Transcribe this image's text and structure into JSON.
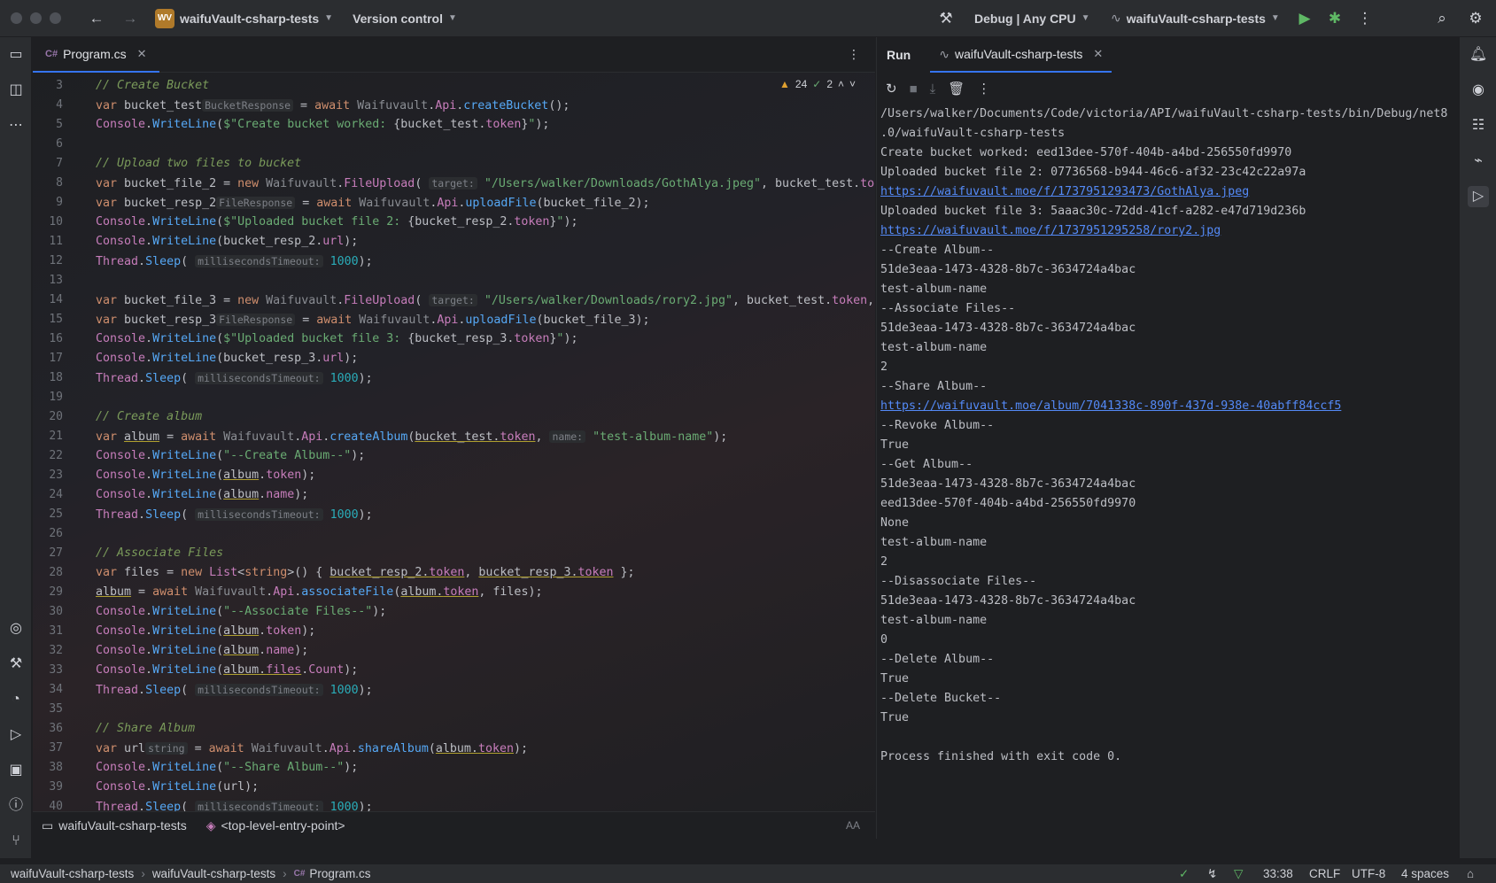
{
  "titlebar": {
    "project_badge": "WV",
    "project_name": "waifuVault-csharp-tests",
    "vcs": "Version control",
    "config": "Debug | Any CPU",
    "run_config": "waifuVault-csharp-tests"
  },
  "editor": {
    "tab_label": "Program.cs",
    "tab_lang": "C#",
    "warnings": "24",
    "weak": "2",
    "lines": [
      {
        "n": "3",
        "html": "<span class=\"cm\">// Create Bucket</span>"
      },
      {
        "n": "4",
        "html": "<span class=\"kw\">var</span> bucket_test<span class=\"hint\">BucketResponse</span> = <span class=\"kw\">await</span> <span class=\"ns\">Waifuvault</span>.<span class=\"ty\">Api</span>.<span class=\"fn\">createBucket</span>();"
      },
      {
        "n": "5",
        "html": "<span class=\"ty\">Console</span>.<span class=\"fn\">WriteLine</span>(<span class=\"str\">$\"Create bucket worked: </span>{bucket_test.<span class=\"prop\">token</span>}<span class=\"str\">\"</span>);"
      },
      {
        "n": "6",
        "html": ""
      },
      {
        "n": "7",
        "html": "<span class=\"cm\">// Upload two files to bucket</span>"
      },
      {
        "n": "8",
        "html": "<span class=\"kw\">var</span> bucket_file_2 = <span class=\"kw\">new</span> <span class=\"ns\">Waifuvault</span>.<span class=\"ty\">FileUpload</span>( <span class=\"hint\">target:</span> <span class=\"str\">\"/Users/walker/Downloads/GothAlya.jpeg\"</span>, bucket_test.<span class=\"prop\">token</span>, <span class=\"hint\">e</span>"
      },
      {
        "n": "9",
        "html": "<span class=\"kw\">var</span> bucket_resp_2<span class=\"hint\">FileResponse</span> = <span class=\"kw\">await</span> <span class=\"ns\">Waifuvault</span>.<span class=\"ty\">Api</span>.<span class=\"fn\">uploadFile</span>(bucket_file_2);"
      },
      {
        "n": "10",
        "html": "<span class=\"ty\">Console</span>.<span class=\"fn\">WriteLine</span>(<span class=\"str\">$\"Uploaded bucket file 2: </span>{bucket_resp_2.<span class=\"prop\">token</span>}<span class=\"str\">\"</span>);"
      },
      {
        "n": "11",
        "html": "<span class=\"ty\">Console</span>.<span class=\"fn\">WriteLine</span>(bucket_resp_2.<span class=\"prop\">url</span>);"
      },
      {
        "n": "12",
        "html": "<span class=\"ty\">Thread</span>.<span class=\"fn\">Sleep</span>( <span class=\"hint\">millisecondsTimeout:</span> <span class=\"num\">1000</span>);"
      },
      {
        "n": "13",
        "html": ""
      },
      {
        "n": "14",
        "html": "<span class=\"kw\">var</span> bucket_file_3 = <span class=\"kw\">new</span> <span class=\"ns\">Waifuvault</span>.<span class=\"ty\">FileUpload</span>( <span class=\"hint\">target:</span> <span class=\"str\">\"/Users/walker/Downloads/rory2.jpg\"</span>, bucket_test.<span class=\"prop\">token</span>, <span class=\"hint\">expires</span>"
      },
      {
        "n": "15",
        "html": "<span class=\"kw\">var</span> bucket_resp_3<span class=\"hint\">FileResponse</span> = <span class=\"kw\">await</span> <span class=\"ns\">Waifuvault</span>.<span class=\"ty\">Api</span>.<span class=\"fn\">uploadFile</span>(bucket_file_3);"
      },
      {
        "n": "16",
        "html": "<span class=\"ty\">Console</span>.<span class=\"fn\">WriteLine</span>(<span class=\"str\">$\"Uploaded bucket file 3: </span>{bucket_resp_3.<span class=\"prop\">token</span>}<span class=\"str\">\"</span>);"
      },
      {
        "n": "17",
        "html": "<span class=\"ty\">Console</span>.<span class=\"fn\">WriteLine</span>(bucket_resp_3.<span class=\"prop\">url</span>);"
      },
      {
        "n": "18",
        "html": "<span class=\"ty\">Thread</span>.<span class=\"fn\">Sleep</span>( <span class=\"hint\">millisecondsTimeout:</span> <span class=\"num\">1000</span>);"
      },
      {
        "n": "19",
        "html": ""
      },
      {
        "n": "20",
        "html": "<span class=\"cm\">// Create album</span>"
      },
      {
        "n": "21",
        "html": "<span class=\"kw\">var</span> <span class=\"und\">album</span> = <span class=\"kw\">await</span> <span class=\"ns\">Waifuvault</span>.<span class=\"ty\">Api</span>.<span class=\"fn\">createAlbum</span>(<span class=\"und\">bucket_test.<span class=\"prop\">token</span></span>, <span class=\"hint\">name:</span> <span class=\"str\">\"test-album-name\"</span>);"
      },
      {
        "n": "22",
        "html": "<span class=\"ty\">Console</span>.<span class=\"fn\">WriteLine</span>(<span class=\"str\">\"--Create Album--\"</span>);"
      },
      {
        "n": "23",
        "html": "<span class=\"ty\">Console</span>.<span class=\"fn\">WriteLine</span>(<span class=\"und\">album</span>.<span class=\"prop\">token</span>);"
      },
      {
        "n": "24",
        "html": "<span class=\"ty\">Console</span>.<span class=\"fn\">WriteLine</span>(<span class=\"und\">album</span>.<span class=\"prop\">name</span>);"
      },
      {
        "n": "25",
        "html": "<span class=\"ty\">Thread</span>.<span class=\"fn\">Sleep</span>( <span class=\"hint\">millisecondsTimeout:</span> <span class=\"num\">1000</span>);"
      },
      {
        "n": "26",
        "html": ""
      },
      {
        "n": "27",
        "html": "<span class=\"cm\">// Associate Files</span>"
      },
      {
        "n": "28",
        "html": "<span class=\"kw\">var</span> files = <span class=\"kw\">new</span> <span class=\"ty\">List</span>&lt;<span class=\"kw\">string</span>&gt;() { <span class=\"und\">bucket_resp_2.<span class=\"prop\">token</span></span>, <span class=\"und\">bucket_resp_3.<span class=\"prop\">token</span></span> };"
      },
      {
        "n": "29",
        "html": "<span class=\"und\">album</span> = <span class=\"kw\">await</span> <span class=\"ns\">Waifuvault</span>.<span class=\"ty\">Api</span>.<span class=\"fn\">associateFile</span>(<span class=\"und\">album.<span class=\"prop\">token</span></span>, files);"
      },
      {
        "n": "30",
        "html": "<span class=\"ty\">Console</span>.<span class=\"fn\">WriteLine</span>(<span class=\"str\">\"--Associate Files--\"</span>);"
      },
      {
        "n": "31",
        "html": "<span class=\"ty\">Console</span>.<span class=\"fn\">WriteLine</span>(<span class=\"und\">album</span>.<span class=\"prop\">token</span>);"
      },
      {
        "n": "32",
        "html": "<span class=\"ty\">Console</span>.<span class=\"fn\">WriteLine</span>(<span class=\"und\">album</span>.<span class=\"prop\">name</span>);"
      },
      {
        "n": "33",
        "html": "<span class=\"ty\">Console</span>.<span class=\"fn\">WriteLine</span>(<span class=\"und\">album.<span class=\"prop\">files</span></span>.<span class=\"prop\">Count</span>);"
      },
      {
        "n": "34",
        "html": "<span class=\"ty\">Thread</span>.<span class=\"fn\">Sleep</span>( <span class=\"hint\">millisecondsTimeout:</span> <span class=\"num\">1000</span>);"
      },
      {
        "n": "35",
        "html": ""
      },
      {
        "n": "36",
        "html": "<span class=\"cm\">// Share Album</span>"
      },
      {
        "n": "37",
        "html": "<span class=\"kw\">var</span> url<span class=\"hint\">string</span> = <span class=\"kw\">await</span> <span class=\"ns\">Waifuvault</span>.<span class=\"ty\">Api</span>.<span class=\"fn\">shareAlbum</span>(<span class=\"und\">album.<span class=\"prop\">token</span></span>);"
      },
      {
        "n": "38",
        "html": "<span class=\"ty\">Console</span>.<span class=\"fn\">WriteLine</span>(<span class=\"str\">\"--Share Album--\"</span>);"
      },
      {
        "n": "39",
        "html": "<span class=\"ty\">Console</span>.<span class=\"fn\">WriteLine</span>(url);"
      },
      {
        "n": "40",
        "html": "<span class=\"ty\">Thread</span>.<span class=\"fn\">Sleep</span>( <span class=\"hint\">millisecondsTimeout:</span> <span class=\"num\">1000</span>);"
      },
      {
        "n": "41",
        "html": ""
      }
    ],
    "bread_project": "waifuVault-csharp-tests",
    "bread_scope": "<top-level-entry-point>"
  },
  "run": {
    "label": "Run",
    "tab_label": "waifuVault-csharp-tests",
    "console": [
      {
        "t": "/Users/walker/Documents/Code/victoria/API/waifuVault-csharp-tests/bin/Debug/net8",
        "link": false
      },
      {
        "t": ".0/waifuVault-csharp-tests",
        "link": false
      },
      {
        "t": "Create bucket worked: eed13dee-570f-404b-a4bd-256550fd9970",
        "link": false
      },
      {
        "t": "Uploaded bucket file 2: 07736568-b944-46c6-af32-23c42c22a97a",
        "link": false
      },
      {
        "t": "https://waifuvault.moe/f/1737951293473/GothAlya.jpeg",
        "link": true
      },
      {
        "t": "Uploaded bucket file 3: 5aaac30c-72dd-41cf-a282-e47d719d236b",
        "link": false
      },
      {
        "t": "https://waifuvault.moe/f/1737951295258/rory2.jpg",
        "link": true
      },
      {
        "t": "--Create Album--",
        "link": false
      },
      {
        "t": "51de3eaa-1473-4328-8b7c-3634724a4bac",
        "link": false
      },
      {
        "t": "test-album-name",
        "link": false
      },
      {
        "t": "--Associate Files--",
        "link": false
      },
      {
        "t": "51de3eaa-1473-4328-8b7c-3634724a4bac",
        "link": false
      },
      {
        "t": "test-album-name",
        "link": false
      },
      {
        "t": "2",
        "link": false
      },
      {
        "t": "--Share Album--",
        "link": false
      },
      {
        "t": "https://waifuvault.moe/album/7041338c-890f-437d-938e-40abff84ccf5",
        "link": true
      },
      {
        "t": "--Revoke Album--",
        "link": false
      },
      {
        "t": "True",
        "link": false
      },
      {
        "t": "--Get Album--",
        "link": false
      },
      {
        "t": "51de3eaa-1473-4328-8b7c-3634724a4bac",
        "link": false
      },
      {
        "t": "eed13dee-570f-404b-a4bd-256550fd9970",
        "link": false
      },
      {
        "t": "None",
        "link": false
      },
      {
        "t": "test-album-name",
        "link": false
      },
      {
        "t": "2",
        "link": false
      },
      {
        "t": "--Disassociate Files--",
        "link": false
      },
      {
        "t": "51de3eaa-1473-4328-8b7c-3634724a4bac",
        "link": false
      },
      {
        "t": "test-album-name",
        "link": false
      },
      {
        "t": "0",
        "link": false
      },
      {
        "t": "--Delete Album--",
        "link": false
      },
      {
        "t": "True",
        "link": false
      },
      {
        "t": "--Delete Bucket--",
        "link": false
      },
      {
        "t": "True",
        "link": false
      },
      {
        "t": "",
        "link": false
      },
      {
        "t": "Process finished with exit code 0.",
        "link": false
      }
    ]
  },
  "statusbar": {
    "crumb1": "waifuVault-csharp-tests",
    "crumb2": "waifuVault-csharp-tests",
    "crumb3": "Program.cs",
    "position": "33:38",
    "line_sep": "CRLF",
    "encoding": "UTF-8",
    "indent": "4 spaces"
  }
}
